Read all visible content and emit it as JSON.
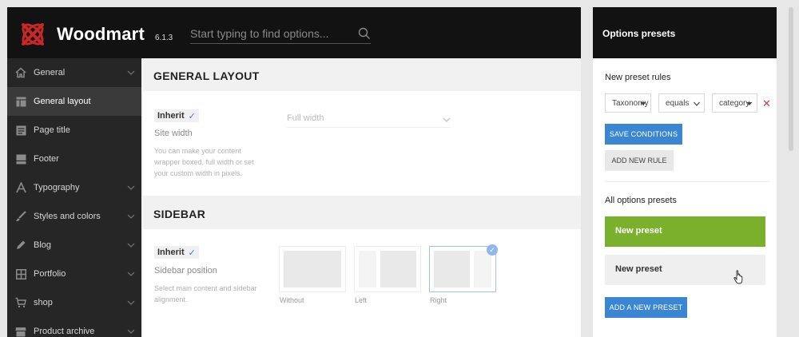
{
  "header": {
    "brand": "Woodmart",
    "version": "6.1.3",
    "search_placeholder": "Start typing to find options..."
  },
  "sidebar": {
    "items": [
      {
        "label": "General",
        "icon": "home-icon",
        "has_chevron": true,
        "active": false
      },
      {
        "label": "General layout",
        "icon": "layout-icon",
        "has_chevron": false,
        "active": true
      },
      {
        "label": "Page title",
        "icon": "page-title-icon",
        "has_chevron": false,
        "active": false
      },
      {
        "label": "Footer",
        "icon": "footer-icon",
        "has_chevron": false,
        "active": false
      },
      {
        "label": "Typography",
        "icon": "typography-icon",
        "has_chevron": true,
        "active": false
      },
      {
        "label": "Styles and colors",
        "icon": "brush-icon",
        "has_chevron": true,
        "active": false
      },
      {
        "label": "Blog",
        "icon": "pencil-icon",
        "has_chevron": true,
        "active": false
      },
      {
        "label": "Portfolio",
        "icon": "grid-icon",
        "has_chevron": true,
        "active": false
      },
      {
        "label": "shop",
        "icon": "cart-icon",
        "has_chevron": true,
        "active": false
      },
      {
        "label": "Product archive",
        "icon": "store-icon",
        "has_chevron": true,
        "active": false
      }
    ]
  },
  "main": {
    "general_layout": {
      "title": "GENERAL LAYOUT",
      "inherit_label": "Inherit",
      "option_label": "Site width",
      "description": "You can make your content wrapper boxed, full width or set your custom width in pixels.",
      "select_value": "Full width"
    },
    "sidebar_section": {
      "title": "SIDEBAR",
      "inherit_label": "Inherit",
      "option_label": "Sidebar position",
      "description": "Select main content and sidebar alignment.",
      "options": [
        {
          "caption": "Without",
          "selected": false
        },
        {
          "caption": "Left",
          "selected": false
        },
        {
          "caption": "Right",
          "selected": true
        }
      ]
    }
  },
  "presets": {
    "title": "Options presets",
    "new_rules_title": "New preset rules",
    "rule": {
      "field": "Taxonomy",
      "operator": "equals",
      "value": "category"
    },
    "save_conditions": "SAVE CONDITIONS",
    "add_new_rule": "ADD NEW RULE",
    "all_presets_title": "All options presets",
    "items": [
      {
        "label": "New preset",
        "active": true
      },
      {
        "label": "New preset",
        "active": false
      }
    ],
    "add_preset": "ADD A NEW PRESET"
  },
  "colors": {
    "header_bg": "#121212",
    "sidebar_bg": "#262626",
    "accent_blue": "#3b86d3",
    "preset_green": "#7ab02c",
    "remove_red": "#d03b3b"
  }
}
